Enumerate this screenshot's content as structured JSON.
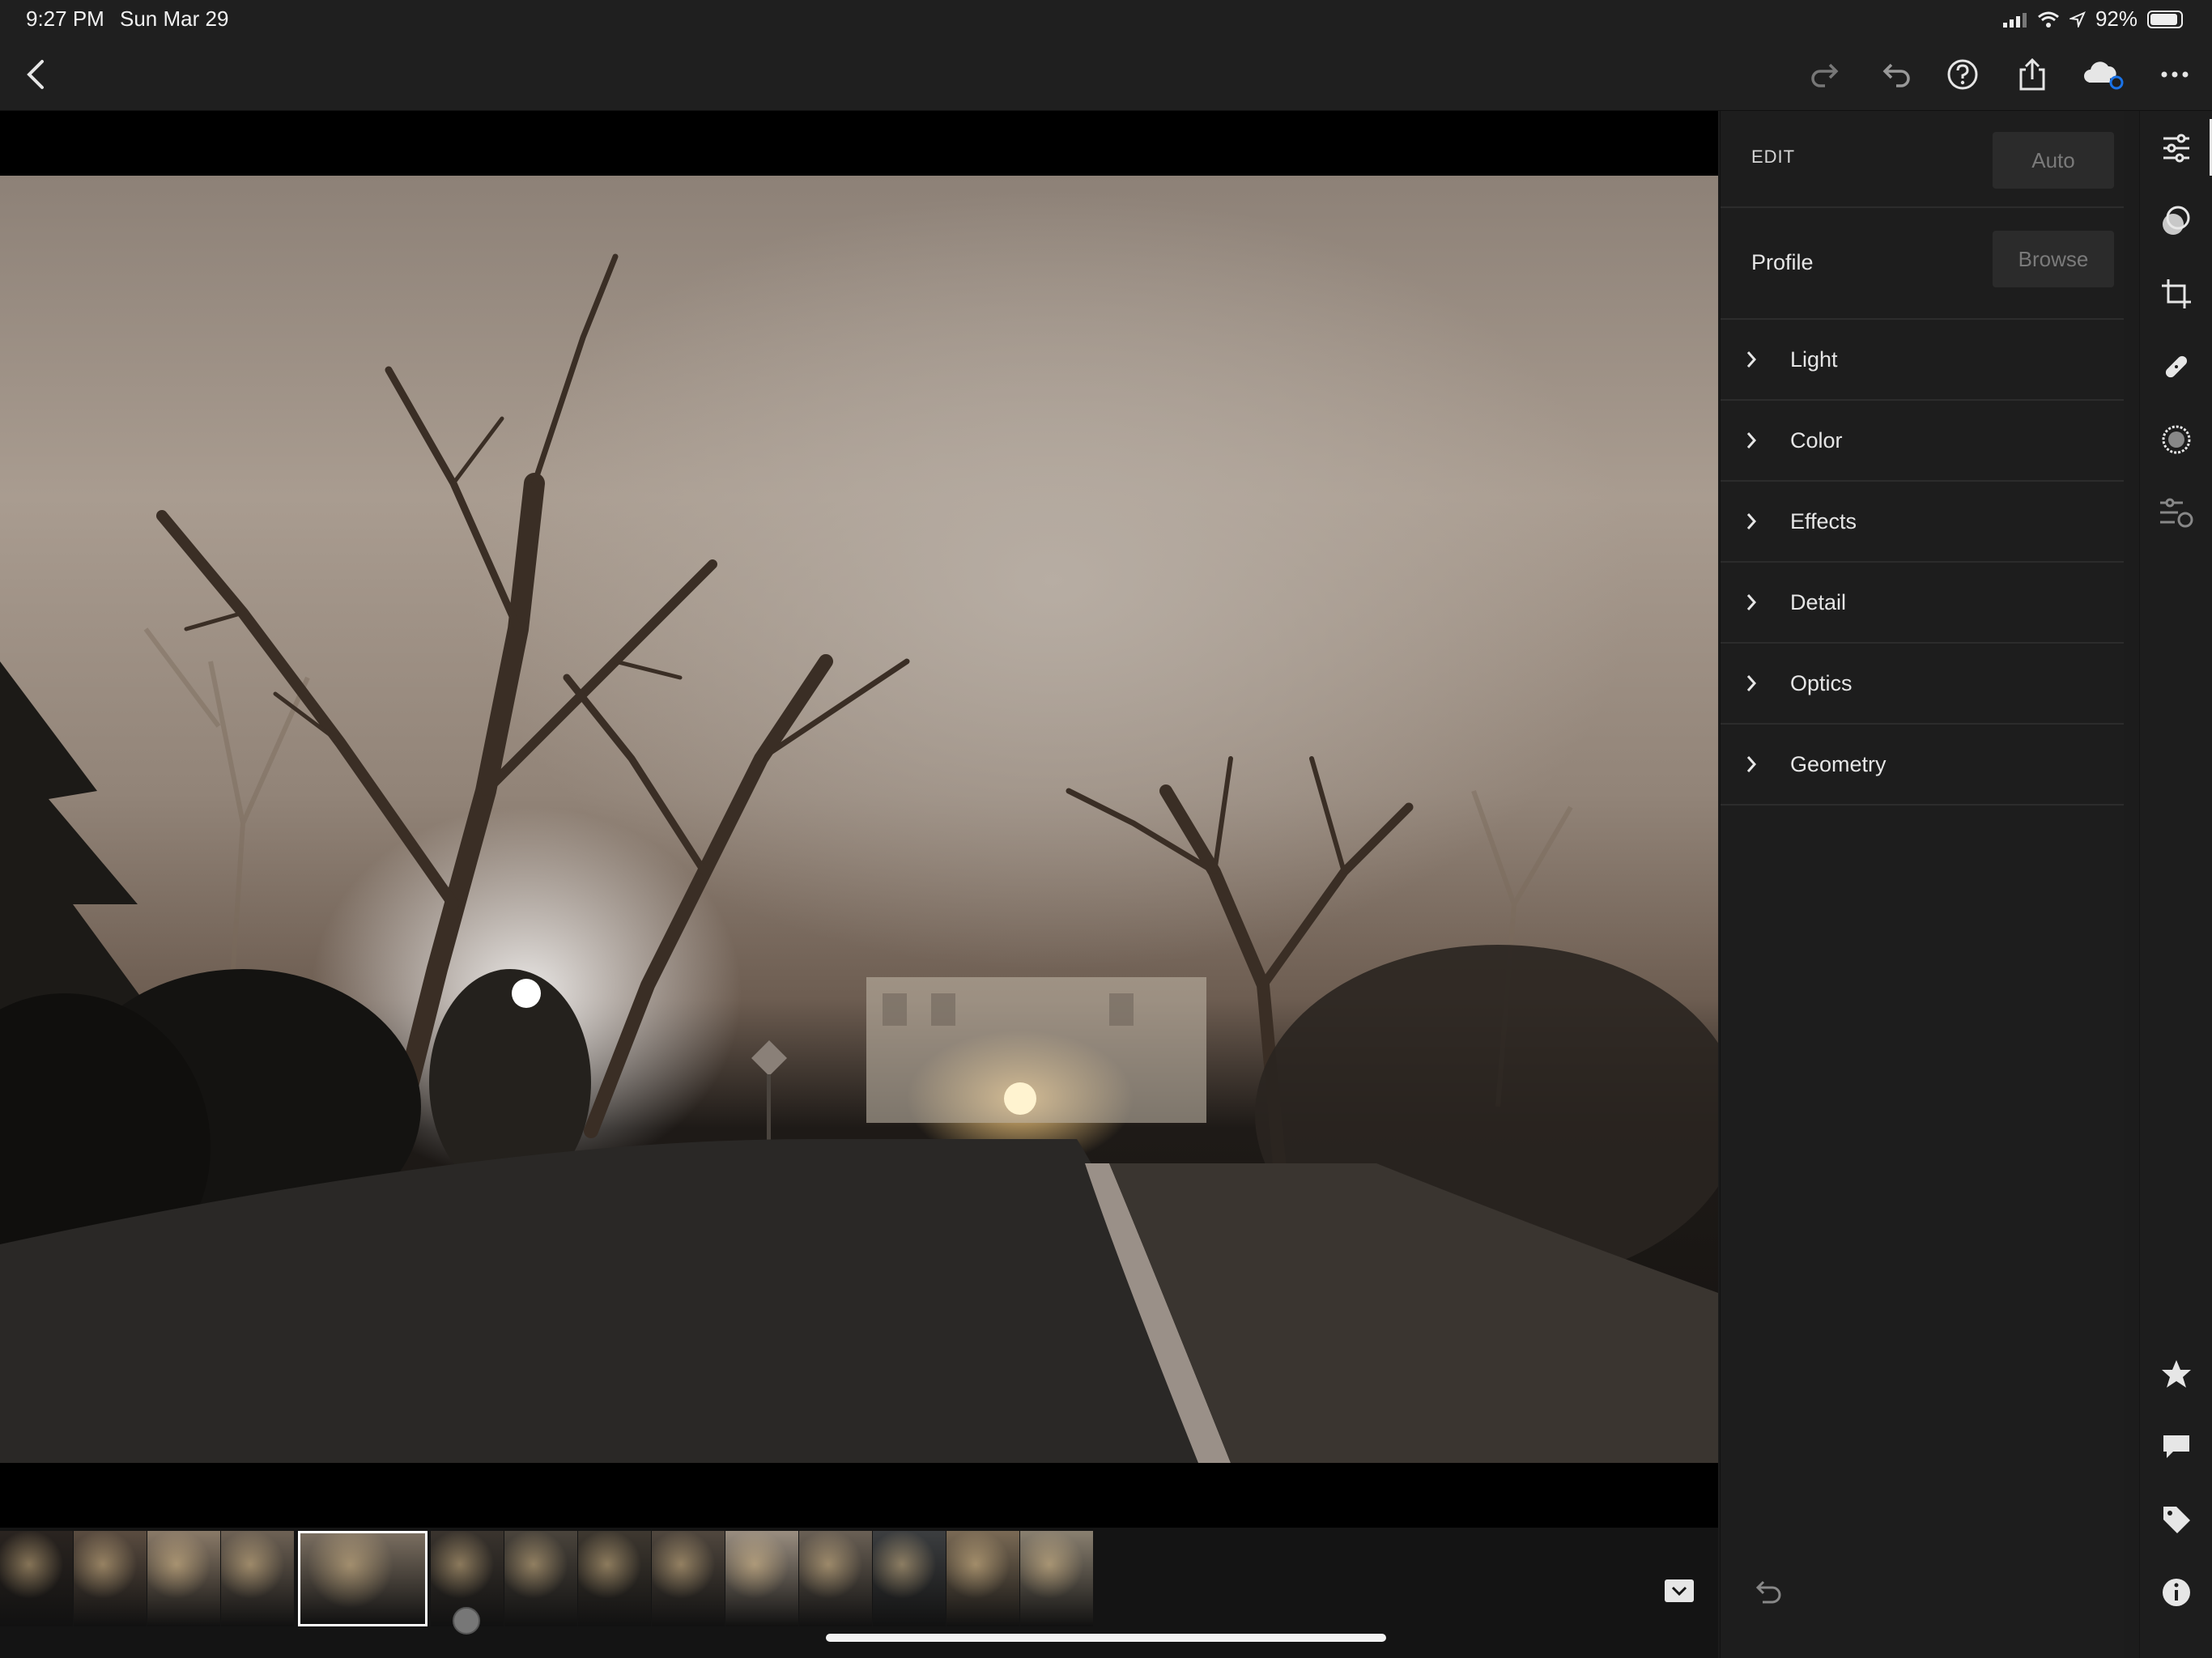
{
  "status": {
    "time": "9:27 PM",
    "date": "Sun Mar 29",
    "battery": "92%"
  },
  "toolbar": {
    "back_icon": "chevron-left-icon",
    "redo_icon": "redo-icon",
    "undo_icon": "undo-icon",
    "help_icon": "help-icon",
    "share_icon": "share-icon",
    "cloud_icon": "cloud-sync-icon",
    "more_icon": "more-icon"
  },
  "panel": {
    "edit_label": "EDIT",
    "auto_label": "Auto",
    "profile_label": "Profile",
    "browse_label": "Browse",
    "sections": [
      {
        "label": "Light"
      },
      {
        "label": "Color"
      },
      {
        "label": "Effects"
      },
      {
        "label": "Detail"
      },
      {
        "label": "Optics"
      },
      {
        "label": "Geometry"
      }
    ]
  },
  "iconbar": {
    "top": [
      "edit-sliders-icon",
      "presets-icon",
      "crop-icon",
      "healing-icon",
      "masking-icon",
      "versions-icon"
    ],
    "bottom": [
      "star-icon",
      "comment-icon",
      "tag-icon",
      "info-icon"
    ]
  },
  "filmstrip": {
    "selected_index": 4,
    "thumb_colors": [
      "#2a2420",
      "#5a4c40",
      "#8a7a68",
      "#6e6255",
      "#7a6e60",
      "#3a342e",
      "#4a443c",
      "#3e3830",
      "#50473e",
      "#9a8e80",
      "#6a6055",
      "#3c3e40",
      "#7a6a55",
      "#8a8070"
    ]
  },
  "colors": {
    "accent_cloud": "#1a73e8",
    "panel_bg": "#1d1d1d"
  }
}
